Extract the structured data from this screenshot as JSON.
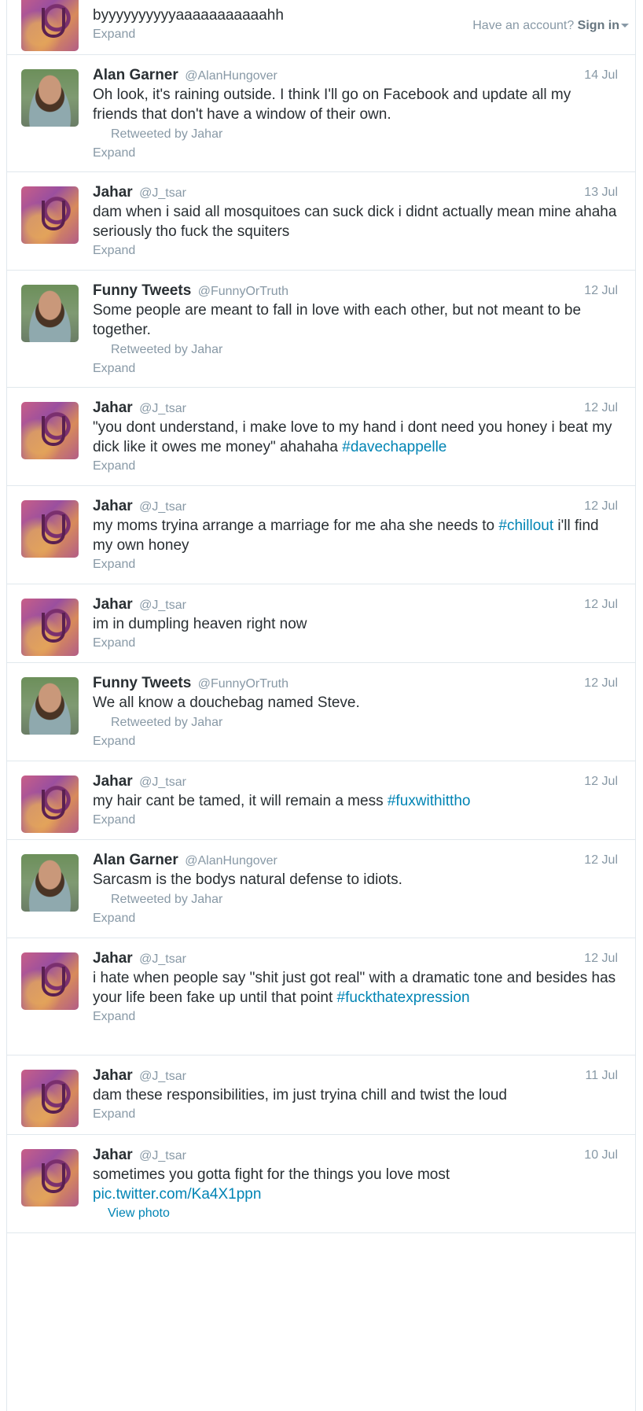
{
  "signin": {
    "prompt": "Have an account?",
    "action": "Sign in"
  },
  "tweets": [
    {
      "avatar": "jahar",
      "name": "",
      "handle": "",
      "time": "",
      "text": "byyyyyyyyyyaaaaaaaaaaahh",
      "retweeted_by": "",
      "expand": "Expand"
    },
    {
      "avatar": "garner",
      "name": "Alan Garner",
      "handle": "@AlanHungover",
      "time": "14 Jul",
      "text": "Oh look, it's raining outside. I think I'll go on Facebook and update all my friends that don't have a window of their own.",
      "retweeted_by": "Retweeted by Jahar",
      "expand": "Expand"
    },
    {
      "avatar": "jahar",
      "name": "Jahar",
      "handle": "@J_tsar",
      "time": "13 Jul",
      "text": "dam when i said all mosquitoes can suck dick i didnt actually mean mine ahaha seriously tho fuck the squiters",
      "retweeted_by": "",
      "expand": "Expand"
    },
    {
      "avatar": "garner",
      "name": "Funny Tweets",
      "handle": "@FunnyOrTruth",
      "time": "12 Jul",
      "text": "Some people are meant to fall in love with each other, but not meant to be together.",
      "retweeted_by": "Retweeted by Jahar",
      "expand": "Expand"
    },
    {
      "avatar": "jahar",
      "name": "Jahar",
      "handle": "@J_tsar",
      "time": "12 Jul",
      "text": "\"you dont understand, i make love to my hand i dont need you honey i beat my dick like it owes me money\" ahahaha ",
      "hashtag": "#davechappelle",
      "retweeted_by": "",
      "expand": "Expand"
    },
    {
      "avatar": "jahar",
      "name": "Jahar",
      "handle": "@J_tsar",
      "time": "12 Jul",
      "text": "my moms tryina arrange a marriage for me aha she needs to ",
      "hashtag": "#chillout",
      "text_after": " i'll find my own honey",
      "retweeted_by": "",
      "expand": "Expand"
    },
    {
      "avatar": "jahar",
      "name": "Jahar",
      "handle": "@J_tsar",
      "time": "12 Jul",
      "text": "im in dumpling heaven right now",
      "retweeted_by": "",
      "expand": "Expand"
    },
    {
      "avatar": "garner",
      "name": "Funny Tweets",
      "handle": "@FunnyOrTruth",
      "time": "12 Jul",
      "text": "We all know a douchebag named Steve.",
      "retweeted_by": "Retweeted by Jahar",
      "expand": "Expand"
    },
    {
      "avatar": "jahar",
      "name": "Jahar",
      "handle": "@J_tsar",
      "time": "12 Jul",
      "text": "my hair cant be tamed, it will remain a mess ",
      "hashtag": "#fuxwithittho",
      "retweeted_by": "",
      "expand": "Expand"
    },
    {
      "avatar": "garner",
      "name": "Alan Garner",
      "handle": "@AlanHungover",
      "time": "12 Jul",
      "text": "Sarcasm is the bodys natural defense to idiots.",
      "retweeted_by": "Retweeted by Jahar",
      "expand": "Expand"
    },
    {
      "avatar": "jahar",
      "name": "Jahar",
      "handle": "@J_tsar",
      "time": "12 Jul",
      "text": "i hate when people say \"shit just got real\" with a dramatic tone and besides has your life been fake up until that point ",
      "hashtag": "#fuckthatexpression",
      "retweeted_by": "",
      "expand": "Expand"
    },
    {
      "avatar": "jahar",
      "name": "Jahar",
      "handle": "@J_tsar",
      "time": "11 Jul",
      "text": "dam these responsibilities, im just tryina chill and twist the loud",
      "retweeted_by": "",
      "expand": "Expand"
    },
    {
      "avatar": "jahar",
      "name": "Jahar",
      "handle": "@J_tsar",
      "time": "10 Jul",
      "text": "sometimes you gotta fight for the things you love most ",
      "hashtag": "pic.twitter.com/Ka4X1ppn",
      "retweeted_by": "",
      "expand": "",
      "view_photo": "View photo"
    }
  ]
}
